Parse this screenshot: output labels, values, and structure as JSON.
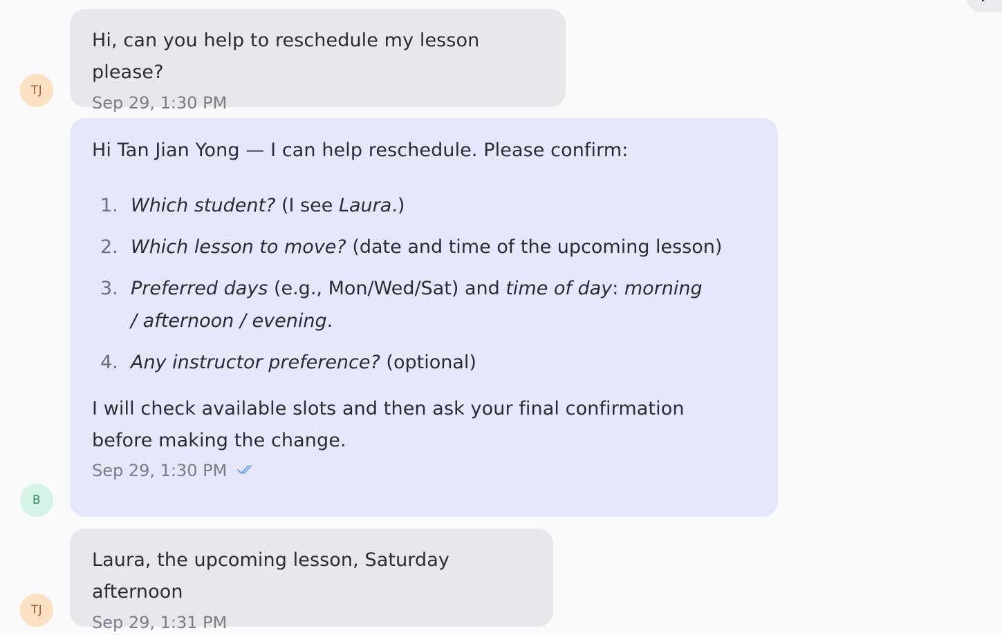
{
  "messages": [
    {
      "sender": "user",
      "avatar_initials": "TJ",
      "text": "Hi, can you help to reschedule my lesson please?",
      "time": "Sep 29, 1:30 PM"
    },
    {
      "sender": "bot",
      "avatar_initials": "B",
      "intro": "Hi Tan Jian Yong — I can help reschedule. Please confirm:",
      "list": [
        {
          "num": "1.",
          "i1": "Which student?",
          "t1": " (I see ",
          "i2": "Laura",
          "t2": ".)"
        },
        {
          "num": "2.",
          "i1": "Which lesson to move?",
          "t1": " (date and time of the upcoming lesson)"
        },
        {
          "num": "3.",
          "i1": "Preferred days",
          "t1": " (e.g., Mon/Wed/Sat) and ",
          "i2": "time of day",
          "t2": ": ",
          "i3": "morning / afternoon / evening",
          "t3": "."
        },
        {
          "num": "4.",
          "i1": "Any instructor preference?",
          "t1": " (optional)"
        }
      ],
      "outro": "I will check available slots and then ask your final confirmation before making the change.",
      "time": "Sep 29, 1:30 PM",
      "read_status_icon": "double-check-icon"
    },
    {
      "sender": "user",
      "avatar_initials": "TJ",
      "text": "Laura, the upcoming lesson, Saturday afternoon",
      "time": "Sep 29, 1:31 PM"
    }
  ],
  "colors": {
    "user_bubble": "#e8e8ec",
    "bot_bubble": "#e6e7fb",
    "user_avatar_bg": "#fbe0c3",
    "bot_avatar_bg": "#d6f3e8",
    "read_check": "#6aa6f0"
  },
  "corner_icon": "chevron-right-icon"
}
